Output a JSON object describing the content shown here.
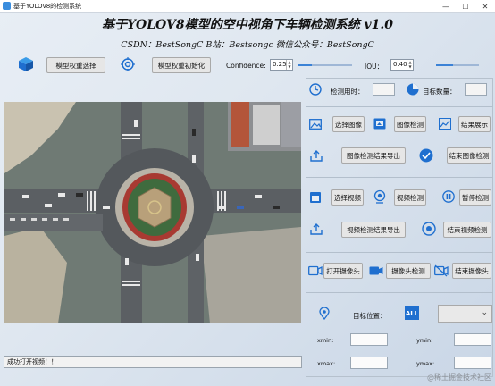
{
  "window": {
    "title": "基于YOLOv8的检测系统",
    "controls": [
      "—",
      "☐",
      "✕"
    ]
  },
  "header": {
    "title": "基于YOLOV8模型的空中视角下车辆检测系统 v1.0",
    "subtitle": "CSDN：BestSongC   B站：Bestsongc   微信公众号：BestSongC"
  },
  "toolbar": {
    "select_weights_label": "模型权重选择",
    "init_weights_label": "模型权重初始化",
    "confidence_label": "Confidence:",
    "confidence_value": "0.25",
    "confidence_level": 0.25,
    "iou_label": "IOU：",
    "iou_value": "0.40",
    "iou_level": 0.4
  },
  "stats": {
    "time_label": "检测用时：",
    "time_value": "",
    "count_label": "目标数量：",
    "count_value": ""
  },
  "image_section": {
    "select_image": "选择图像",
    "detect_image": "图像检测",
    "show_result": "结果展示",
    "export_image": "图像检测结果导出",
    "stop_image": "结束图像检测"
  },
  "video_section": {
    "select_video": "选择视频",
    "detect_video": "视频检测",
    "pause_detect": "暂停检测",
    "export_video": "视频检测结果导出",
    "stop_video": "结束视频检测"
  },
  "camera_section": {
    "open_camera": "打开摄像头",
    "camera_detect": "摄像头检测",
    "close_camera": "结束摄像头"
  },
  "target": {
    "position_label": "目标位置：",
    "select_value": "",
    "all_icon_text": "ALL",
    "xmin_label": "xmin:",
    "ymin_label": "ymin:",
    "xmax_label": "xmax:",
    "ymax_label": "ymax:",
    "xmin": "",
    "ymin": "",
    "xmax": "",
    "ymax": ""
  },
  "status": {
    "message": "成功打开视频！！"
  },
  "watermark": "@稀土掘金技术社区",
  "colors": {
    "accent": "#2f7fd6",
    "icon_blue": "#1f6fcf",
    "button_bg": "#e6e6e6"
  }
}
